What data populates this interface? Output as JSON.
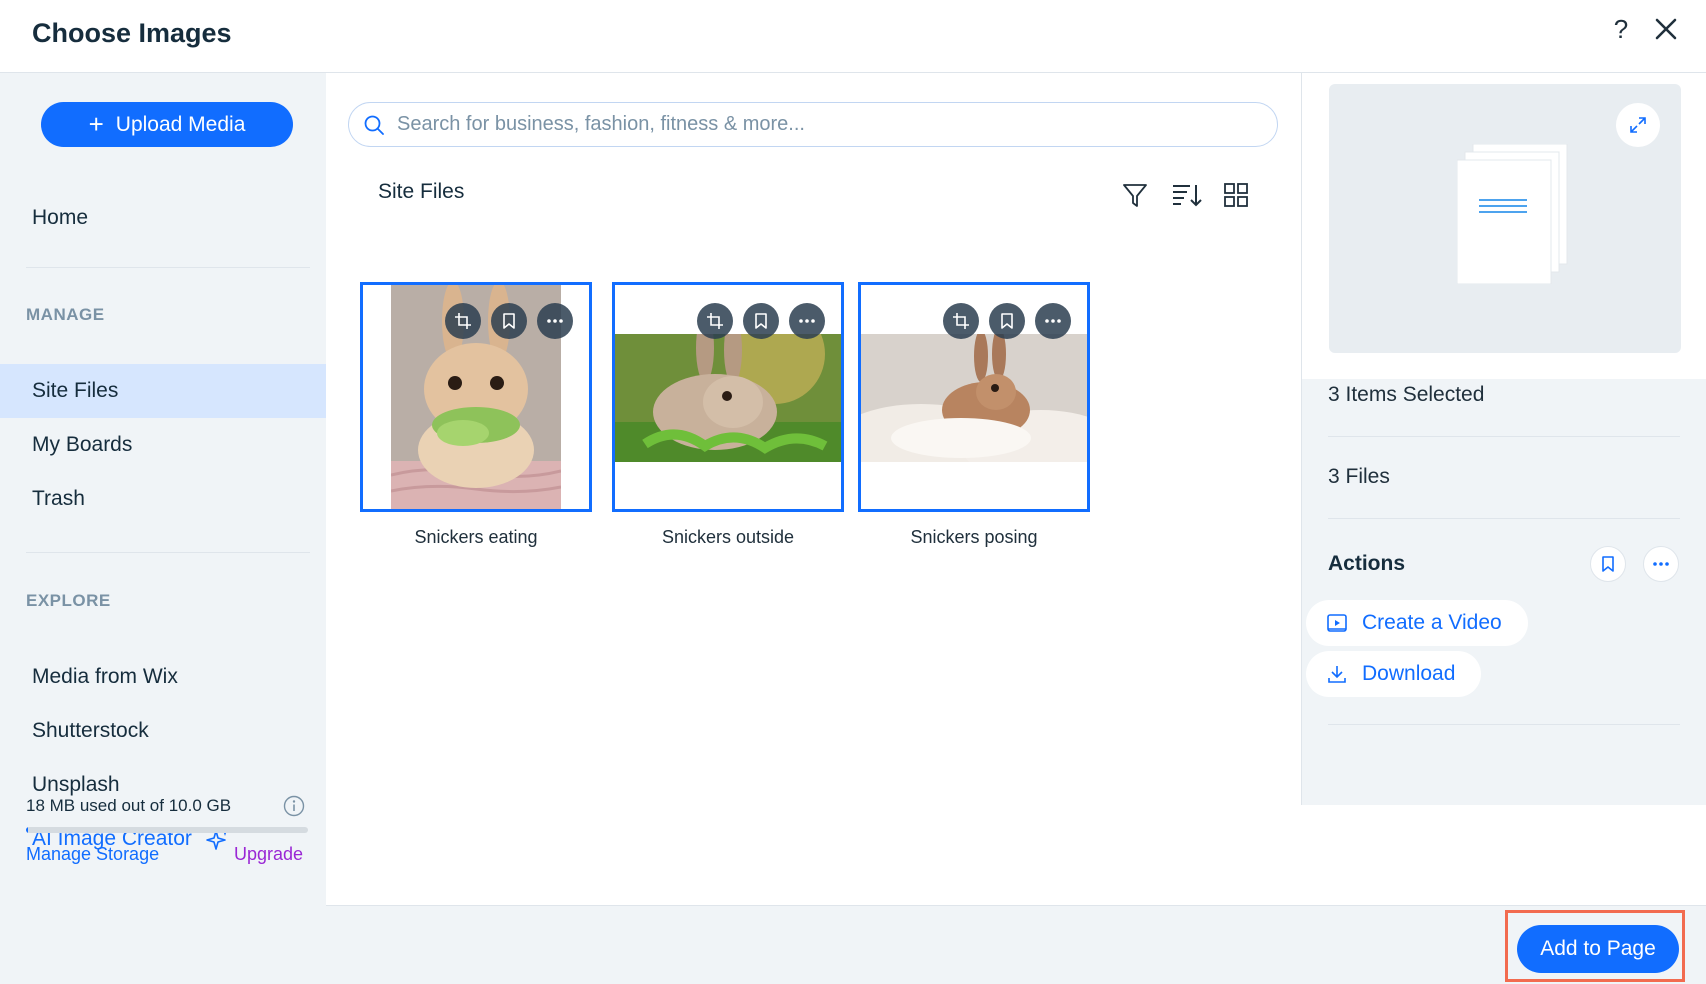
{
  "header": {
    "title": "Choose Images",
    "help_label": "?"
  },
  "sidebar": {
    "upload_label": "Upload Media",
    "home": "Home",
    "manage_label": "MANAGE",
    "manage_items": [
      "Site Files",
      "My Boards",
      "Trash"
    ],
    "explore_label": "EXPLORE",
    "explore_items": [
      "Media from Wix",
      "Shutterstock",
      "Unsplash",
      "AI Image Creator"
    ],
    "storage": {
      "text": "18 MB used out of 10.0 GB",
      "used_fraction": 0.0018
    },
    "manage_storage": "Manage Storage",
    "upgrade": "Upgrade"
  },
  "main": {
    "search_placeholder": "Search for business, fashion, fitness & more...",
    "folder_title": "Site Files",
    "files": [
      {
        "name": "Snickers eating",
        "selected": true
      },
      {
        "name": "Snickers outside",
        "selected": true
      },
      {
        "name": "Snickers posing",
        "selected": true
      }
    ]
  },
  "panel": {
    "selected_text": "3 Items Selected",
    "files_text": "3 Files",
    "actions_title": "Actions",
    "create_video": "Create a Video",
    "download": "Download"
  },
  "footer": {
    "add_label": "Add to Page"
  },
  "colors": {
    "accent": "#116dff",
    "sidebar_bg": "#f0f4f7",
    "active_bg": "#d6e6fe",
    "upgrade": "#9a27d5",
    "highlight": "#f26b4f"
  },
  "icons": [
    "close-icon",
    "search-icon",
    "filter-icon",
    "sort-icon",
    "grid-view-icon",
    "crop-icon",
    "bookmark-icon",
    "more-icon",
    "expand-icon",
    "info-icon",
    "sparkle-icon",
    "video-icon",
    "download-icon",
    "document-icon"
  ]
}
